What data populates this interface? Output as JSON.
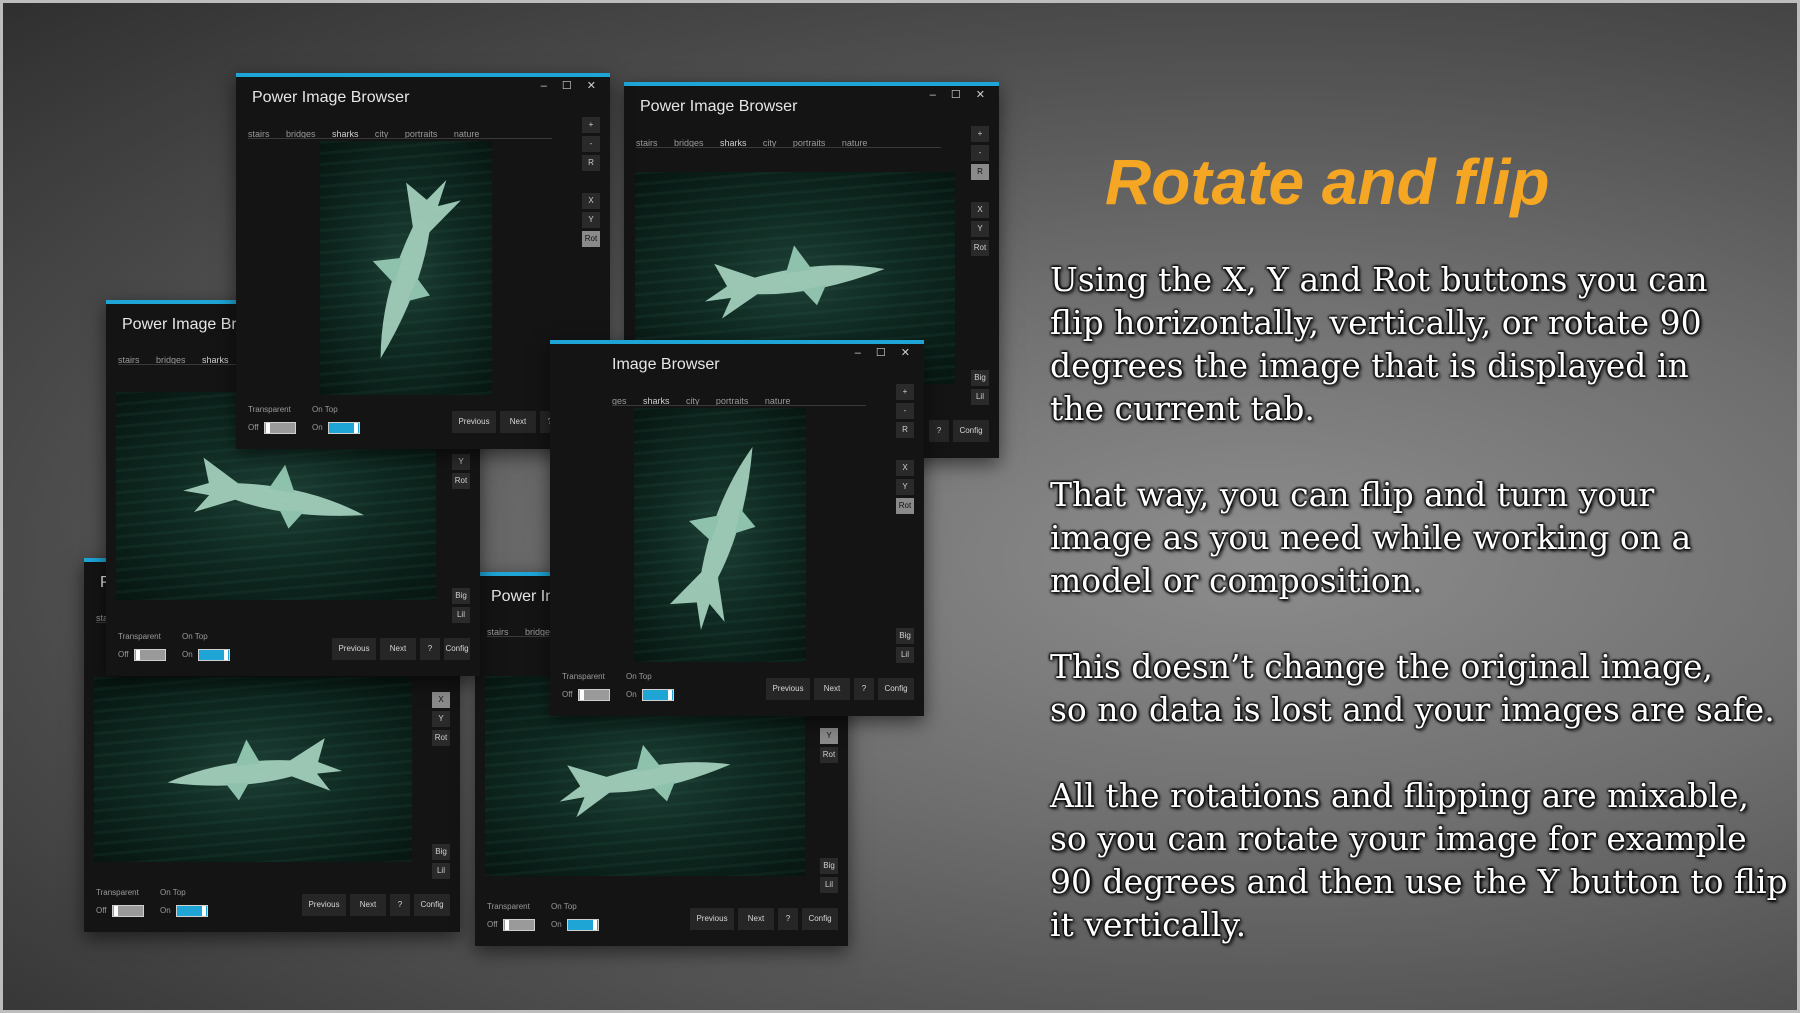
{
  "app": {
    "title": "Power Image Browser",
    "title_partial_image": "Image Browser",
    "title_partial_bro": "Power Image Bro",
    "title_partial_im": "Power Im",
    "title_partial_p": "P",
    "window_controls": "– ☐ ✕",
    "tabs": [
      "stairs",
      "bridges",
      "sharks",
      "city",
      "portraits",
      "nature"
    ],
    "tabs_partial_a": [
      "ges",
      "sharks",
      "city",
      "portraits",
      "nature"
    ],
    "tabs_partial_b": [
      "stairs",
      "bridges",
      "sharks",
      "city"
    ],
    "tabs_partial_c": [
      "stairs",
      "bridges"
    ],
    "tabs_partial_d": [
      "sta"
    ],
    "side_buttons": {
      "plus": "+",
      "minus": "-",
      "reset": "R",
      "flip_x": "X",
      "flip_y": "Y",
      "rotate": "Rot",
      "big": "Big",
      "lil": "Lil"
    },
    "footer": {
      "transparent_label": "Transparent",
      "on_top_label": "On Top",
      "off_label": "Off",
      "on_label": "On",
      "previous": "Previous",
      "next": "Next",
      "help": "?",
      "config": "Config",
      "config_partial": "Config"
    },
    "accent_color": "#1ea5d6"
  },
  "content": {
    "heading": "Rotate and flip",
    "heading_color": "#f5a623",
    "paragraphs": [
      "Using the X, Y and Rot buttons you can\nflip horizontally, vertically, or rotate 90\ndegrees the image that is displayed in\n the current tab.",
      "That way, you can flip and turn your\nimage as you need while working on a\n model or composition.",
      "This doesn’t change the original image,\n so no data is lost and your images are safe.",
      "All the rotations and flipping are mixable,\n so you can rotate your image for example\n 90 degrees and then use the Y button to flip\n it vertically."
    ]
  }
}
